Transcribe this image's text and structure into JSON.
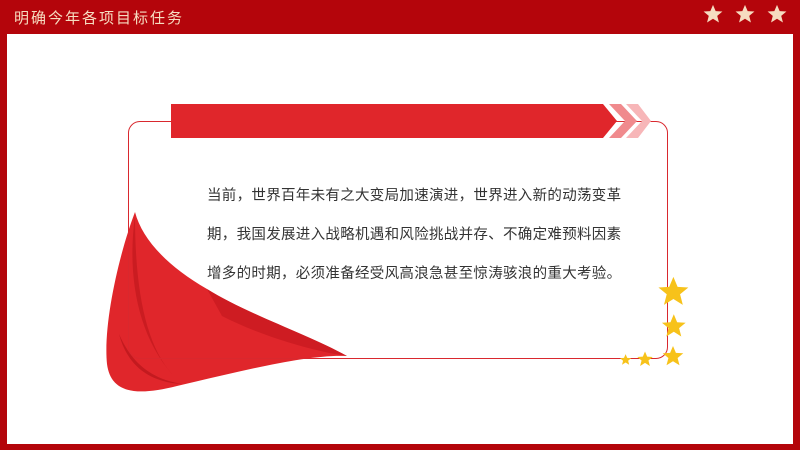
{
  "header": {
    "title": "明确今年各项目标任务",
    "stars": [
      "star-icon",
      "star-icon",
      "star-icon"
    ]
  },
  "main": {
    "paragraph": "当前，世界百年未有之大变局加速演进，世界进入新的动荡变革期，我国发展进入战略机遇和风险挑战并存、不确定难预料因素增多的时期，必须准备经受风高浪急甚至惊涛骇浪的重大考验。"
  },
  "colors": {
    "brand_red": "#b4050b",
    "accent_red": "#e0262b",
    "header_text": "#f6dcc0",
    "star_gold": "#f7c21a"
  }
}
